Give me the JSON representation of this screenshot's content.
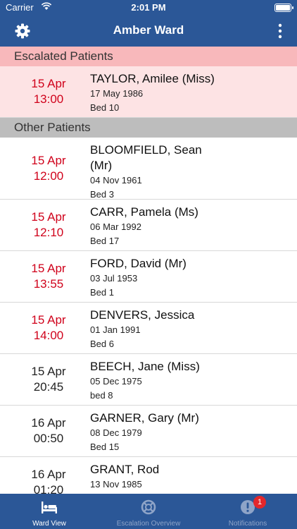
{
  "status_bar": {
    "carrier": "Carrier",
    "time": "2:01 PM"
  },
  "nav": {
    "title": "Amber Ward"
  },
  "sections": {
    "escalated": "Escalated Patients",
    "other": "Other Patients"
  },
  "escalated_patients": [
    {
      "date": "15 Apr",
      "time": "13:00",
      "name": "TAYLOR, Amilee (Miss)",
      "dob": "17 May 1986",
      "bed": "Bed 10"
    }
  ],
  "other_patients": [
    {
      "date": "15 Apr",
      "time": "12:00",
      "name": "BLOOMFIELD, Sean (Mr)",
      "dob": "04 Nov 1961",
      "bed": "Bed 3"
    },
    {
      "date": "15 Apr",
      "time": "12:10",
      "name": "CARR, Pamela (Ms)",
      "dob": "06 Mar 1992",
      "bed": "Bed 17"
    },
    {
      "date": "15 Apr",
      "time": "13:55",
      "name": "FORD, David (Mr)",
      "dob": "03 Jul 1953",
      "bed": "Bed 1"
    },
    {
      "date": "15 Apr",
      "time": "14:00",
      "name": "DENVERS, Jessica",
      "dob": "01 Jan 1991",
      "bed": "Bed 6"
    },
    {
      "date": "15 Apr",
      "time": "20:45",
      "name": "BEECH, Jane (Miss)",
      "dob": "05 Dec 1975",
      "bed": "bed 8"
    },
    {
      "date": "16 Apr",
      "time": "00:50",
      "name": "GARNER, Gary (Mr)",
      "dob": "08 Dec 1979",
      "bed": "Bed 15"
    },
    {
      "date": "16 Apr",
      "time": "01:20",
      "name": "GRANT, Rod",
      "dob": "13 Nov 1985",
      "bed": ""
    }
  ],
  "tabs": [
    {
      "label": "Ward View",
      "icon": "bed-icon"
    },
    {
      "label": "Escalation Overview",
      "icon": "lifebuoy-icon"
    },
    {
      "label": "Notifications",
      "icon": "alert-icon",
      "badge": "1"
    }
  ],
  "colors": {
    "primary": "#2b5797",
    "overdue_red": "#d0021b",
    "escalated_bg": "#fde3e4",
    "escalated_header": "#f8b8bb",
    "badge": "#e3272b"
  }
}
